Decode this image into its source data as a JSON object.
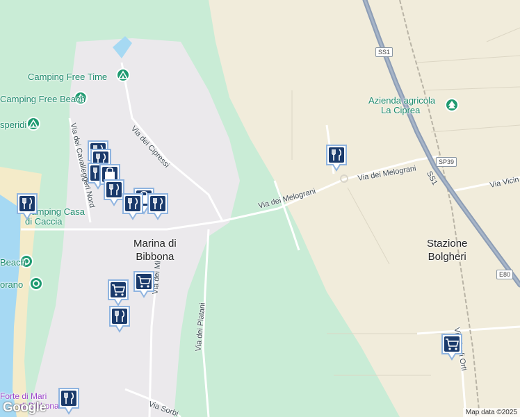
{
  "map": {
    "camping_labels": [
      "Camping Free Time",
      "Camping Free Beach",
      "Camping Casa di Caccia",
      "Campeggio Esperidi"
    ],
    "pois": {
      "camping_free_time": "Camping Free Time",
      "camping_free_beach": "Camping Free Beach",
      "esperidi": "speridi",
      "camping_casa_line1": "Camping Casa",
      "camping_casa_line2": "di Caccia",
      "azienda_line1": "Azienda agricola",
      "azienda_line2": "La Ciprea",
      "beach": "Beach",
      "morano": "orano",
      "forte_line1": "Forte di Mari",
      "forte_line2": "di Bibbona"
    },
    "towns": {
      "marina_line1": "Marina di",
      "marina_line2": "Bibbona",
      "stazione_line1": "Stazione",
      "stazione_line2": "Bolgheri"
    },
    "roads": {
      "via_dei_melograni_west": "Via dei Melograni",
      "via_dei_melograni_east": "Via dei Melograni",
      "via_dei_cipressi": "Via dei Cipressi",
      "via_dei_cavalleggeri": "Via dei Cavalleggeri Nord",
      "via_dei_platani": "Via dei Platani",
      "via_sorbi": "Via Sorbi",
      "via_vicinale": "Via Vicin",
      "via_degli_orti": "Via degli Orti",
      "via_dei_mi": "Via dei Mi"
    },
    "shields": {
      "ss1_north": "SS1",
      "sp39": "SP39",
      "ss1_road_label": "SS1",
      "e80": "E80"
    },
    "attribution": "Map data ©2025",
    "logo": "Google",
    "colors": {
      "forest": "#c9ecd6",
      "sand": "#f1ecdb",
      "water": "#a6d9f3",
      "motorway": "#8d9db5",
      "pin": "#1a3a6b"
    }
  }
}
